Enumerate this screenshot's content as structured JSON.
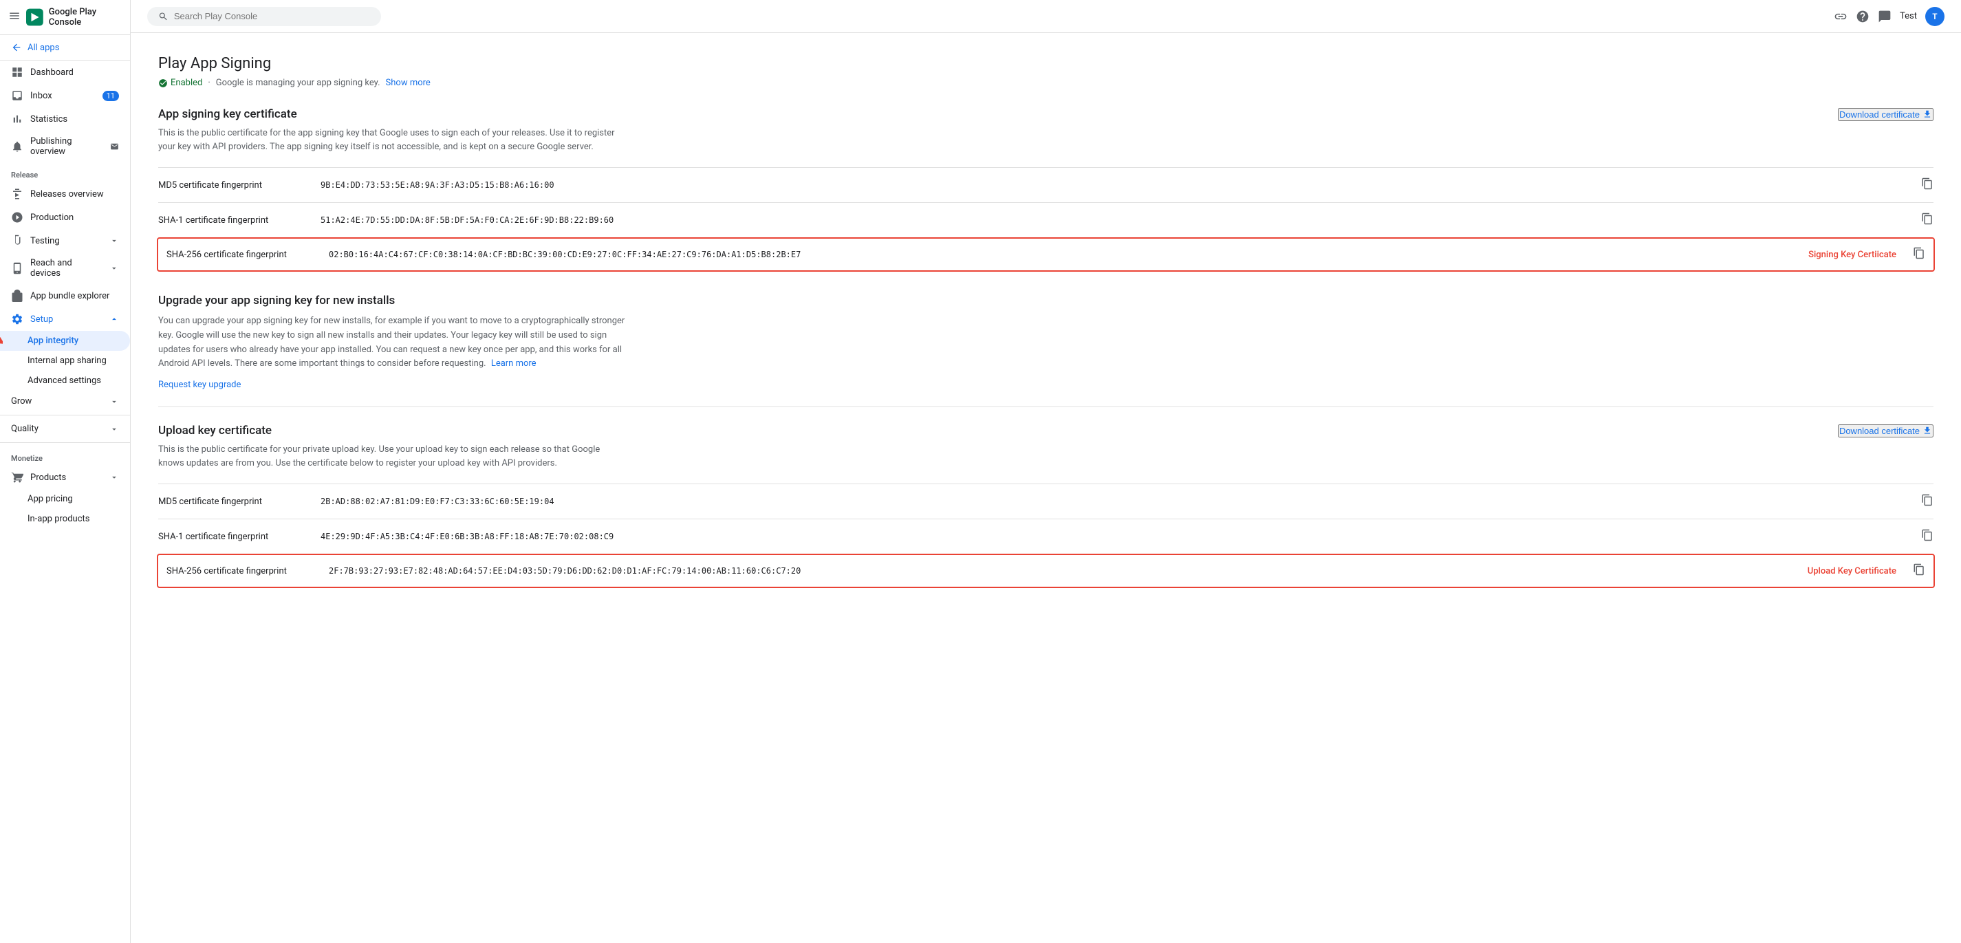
{
  "sidebar": {
    "title": "Google Play Console",
    "all_apps": "All apps",
    "nav_items": [
      {
        "id": "dashboard",
        "label": "Dashboard",
        "icon": "grid"
      },
      {
        "id": "inbox",
        "label": "Inbox",
        "icon": "inbox",
        "badge": "11"
      },
      {
        "id": "statistics",
        "label": "Statistics",
        "icon": "bar-chart"
      },
      {
        "id": "publishing-overview",
        "label": "Publishing overview",
        "icon": "bell"
      }
    ],
    "release_section": "Release",
    "release_items": [
      {
        "id": "releases-overview",
        "label": "Releases overview",
        "icon": "releases"
      },
      {
        "id": "production",
        "label": "Production",
        "icon": "production"
      },
      {
        "id": "testing",
        "label": "Testing",
        "icon": "testing",
        "has_expand": true
      },
      {
        "id": "reach-devices",
        "label": "Reach and devices",
        "icon": "reach"
      },
      {
        "id": "app-bundle",
        "label": "App bundle explorer",
        "icon": "bundle"
      }
    ],
    "setup_item": {
      "id": "setup",
      "label": "Setup",
      "icon": "gear",
      "expanded": true
    },
    "setup_sub_items": [
      {
        "id": "app-integrity",
        "label": "App integrity",
        "active": true
      },
      {
        "id": "internal-app-sharing",
        "label": "Internal app sharing"
      },
      {
        "id": "advanced-settings",
        "label": "Advanced settings"
      }
    ],
    "grow_section": "Grow",
    "quality_section": "Quality",
    "monetize_section": "Monetize",
    "monetize_items": [
      {
        "id": "products",
        "label": "Products",
        "icon": "cart"
      },
      {
        "id": "app-pricing",
        "label": "App pricing"
      },
      {
        "id": "in-app-products",
        "label": "In-app products"
      }
    ]
  },
  "topbar": {
    "search_placeholder": "Search Play Console",
    "link_icon": "link",
    "help_icon": "help",
    "feedback_icon": "feedback",
    "user_label": "Test",
    "avatar_initial": "T"
  },
  "page": {
    "title": "Play App Signing",
    "status": "Enabled",
    "status_desc": "Google is managing your app signing key.",
    "show_more": "Show more",
    "signing_cert_section": {
      "title": "App signing key certificate",
      "desc": "This is the public certificate for the app signing key that Google uses to sign each of your releases. Use it to register your key with API providers. The app signing key itself is not accessible, and is kept on a secure Google server.",
      "download_btn": "Download certificate",
      "rows": [
        {
          "label": "MD5 certificate fingerprint",
          "value": "9B:E4:DD:73:53:5E:A8:9A:3F:A3:D5:15:B8:A6:16:00",
          "highlighted": false
        },
        {
          "label": "SHA-1 certificate fingerprint",
          "value": "51:A2:4E:7D:55:DD:DA:8F:5B:DF:5A:F0:CA:2E:6F:9D:B8:22:B9:60",
          "highlighted": false
        },
        {
          "label": "SHA-256 certificate fingerprint",
          "value": "02:B0:16:4A:C4:67:CF:C0:38:14:0A:CF:BD:BC:39:00:CD:E9:27:0C:FF:34:AE:27:C9:76:DA:A1:D5:B8:2B:E7",
          "highlighted": true,
          "badge": "Signing Key Certiicate"
        }
      ]
    },
    "upgrade_section": {
      "title": "Upgrade your app signing key for new installs",
      "desc": "You can upgrade your app signing key for new installs, for example if you want to move to a cryptographically stronger key. Google will use the new key to sign all new installs and their updates. Your legacy key will still be used to sign updates for users who already have your app installed. You can request a new key once per app, and this works for all Android API levels. There are some important things to consider before requesting.",
      "learn_more": "Learn more",
      "request_link": "Request key upgrade"
    },
    "upload_cert_section": {
      "title": "Upload key certificate",
      "desc": "This is the public certificate for your private upload key. Use your upload key to sign each release so that Google knows updates are from you. Use the certificate below to register your upload key with API providers.",
      "download_btn": "Download certificate",
      "rows": [
        {
          "label": "MD5 certificate fingerprint",
          "value": "2B:AD:88:02:A7:81:D9:E0:F7:C3:33:6C:60:5E:19:04",
          "highlighted": false
        },
        {
          "label": "SHA-1 certificate fingerprint",
          "value": "4E:29:9D:4F:A5:3B:C4:4F:E0:6B:3B:A8:FF:18:A8:7E:70:02:08:C9",
          "highlighted": false
        },
        {
          "label": "SHA-256 certificate fingerprint",
          "value": "2F:7B:93:27:93:E7:82:48:AD:64:57:EE:D4:03:5D:79:D6:DD:62:D0:D1:AF:FC:79:14:00:AB:11:60:C6:C7:20",
          "highlighted": true,
          "badge": "Upload Key Certificate"
        }
      ]
    }
  }
}
